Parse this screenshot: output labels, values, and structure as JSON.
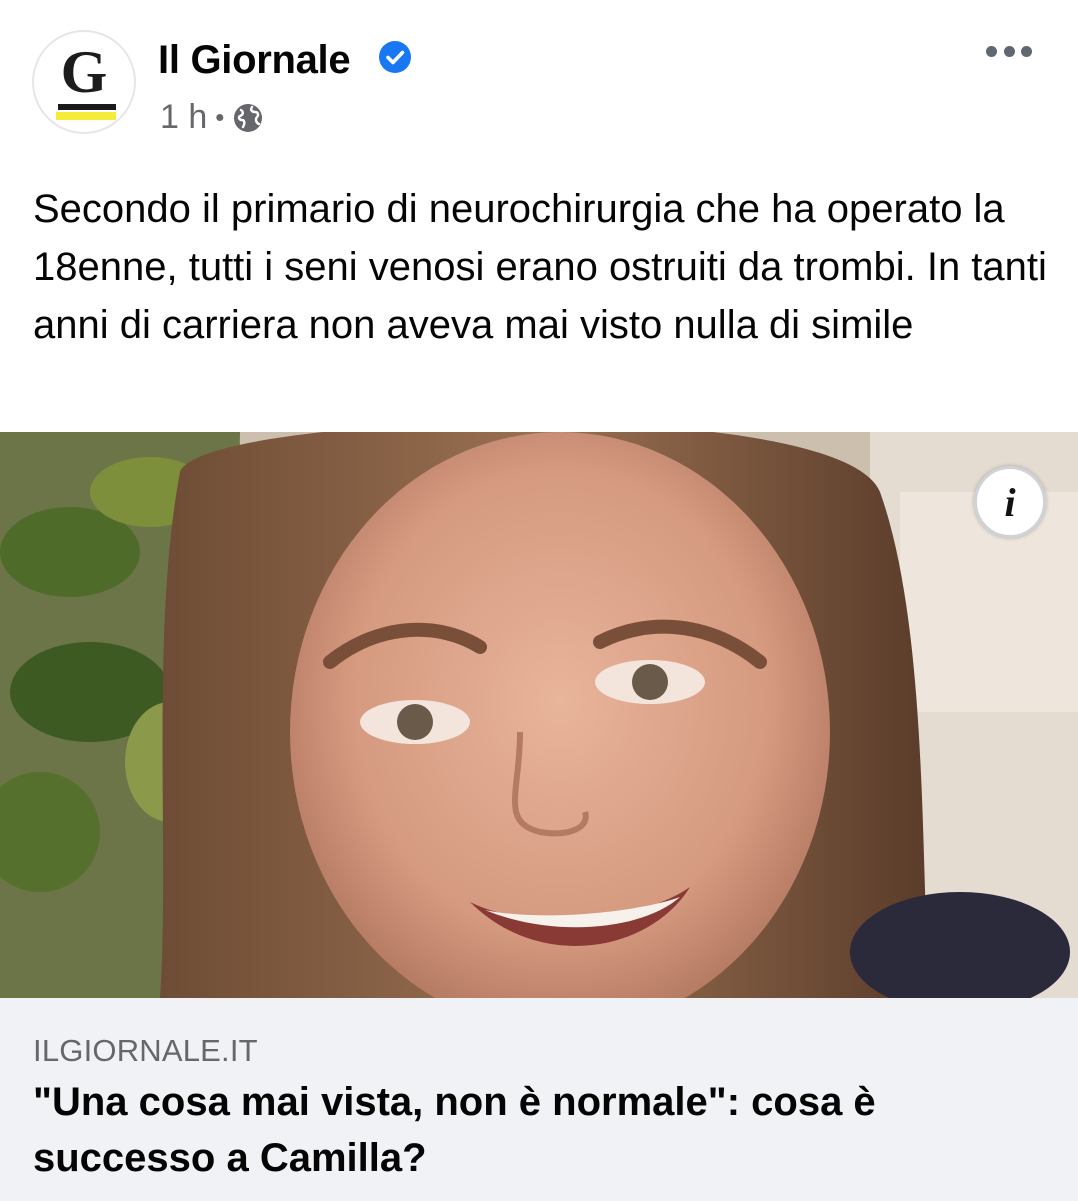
{
  "post": {
    "page_name": "Il Giornale",
    "avatar_letter": "G",
    "verified_icon": "verified-badge-icon",
    "time": "1 h",
    "separator": "•",
    "audience_icon": "globe-icon",
    "more_icon": "more-options-icon",
    "text": "Secondo il primario di neurochirurgia che ha operato la 18enne, tutti i seni venosi erano ostruiti da trombi. In tanti anni di carriera non aveva mai visto nulla di simile"
  },
  "media": {
    "info_label": "i",
    "info_icon": "info-icon"
  },
  "link": {
    "domain": "ILGIORNALE.IT",
    "title": "\"Una cosa mai vista, non è normale\": cosa è successo a Camilla?"
  },
  "colors": {
    "verified_blue": "#1877f2",
    "secondary_text": "#65676b",
    "link_card_bg": "#f0f2f5",
    "logo_yellow": "#f5ec3a"
  }
}
